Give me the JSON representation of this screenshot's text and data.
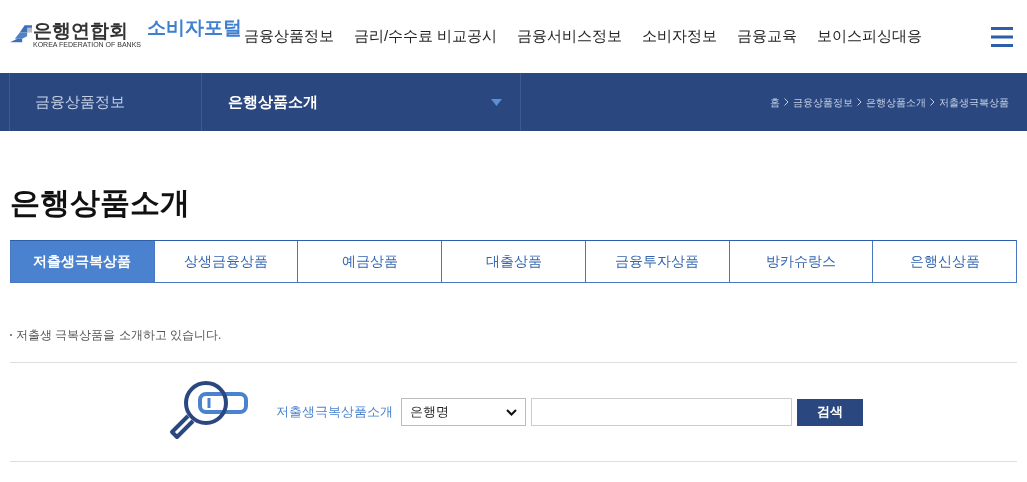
{
  "header": {
    "logo": {
      "name": "은행연합회",
      "subtitle": "KOREA FEDERATION OF BANKS",
      "portal": "소비자포털"
    },
    "menu": [
      "금융상품정보",
      "금리/수수료 비교공시",
      "금융서비스정보",
      "소비자정보",
      "금융교육",
      "보이스피싱대응"
    ]
  },
  "subnav": {
    "section": "금융상품정보",
    "page": "은행상품소개",
    "breadcrumb": [
      "홈",
      "금융상품정보",
      "은행상품소개",
      "저출생극복상품"
    ]
  },
  "title": "은행상품소개",
  "tabs": [
    {
      "label": "저출생극복상품",
      "selected": true
    },
    {
      "label": "상생금융상품",
      "selected": false
    },
    {
      "label": "예금상품",
      "selected": false
    },
    {
      "label": "대출상품",
      "selected": false
    },
    {
      "label": "금융투자상품",
      "selected": false
    },
    {
      "label": "방카슈랑스",
      "selected": false
    },
    {
      "label": "은행신상품",
      "selected": false
    }
  ],
  "intro": "저출생 극복상품을 소개하고 있습니다.",
  "search": {
    "label": "저출생극복상품소개",
    "select_value": "은행명",
    "button": "검색"
  }
}
